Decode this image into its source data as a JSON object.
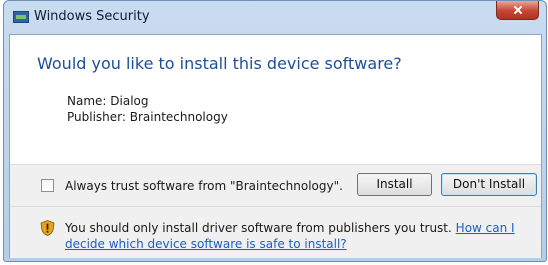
{
  "window": {
    "title": "Windows Security"
  },
  "dialog": {
    "question": "Would you like to install this device software?",
    "name_line": "Name: Dialog",
    "publisher_line": "Publisher: Braintechnology"
  },
  "actions": {
    "checkbox_label": "Always trust software from \"Braintechnology\".",
    "checkbox_checked": false,
    "install_label": "Install",
    "dont_install_label": "Don't Install"
  },
  "footer": {
    "warning_text": "You should only install driver software from publishers you trust.",
    "link_text": "How can I decide which device software is safe to install?"
  },
  "colors": {
    "question_text": "#1f4e99",
    "link": "#1a5fc8",
    "close_button": "#c34634",
    "shield": "#e5a21a"
  }
}
